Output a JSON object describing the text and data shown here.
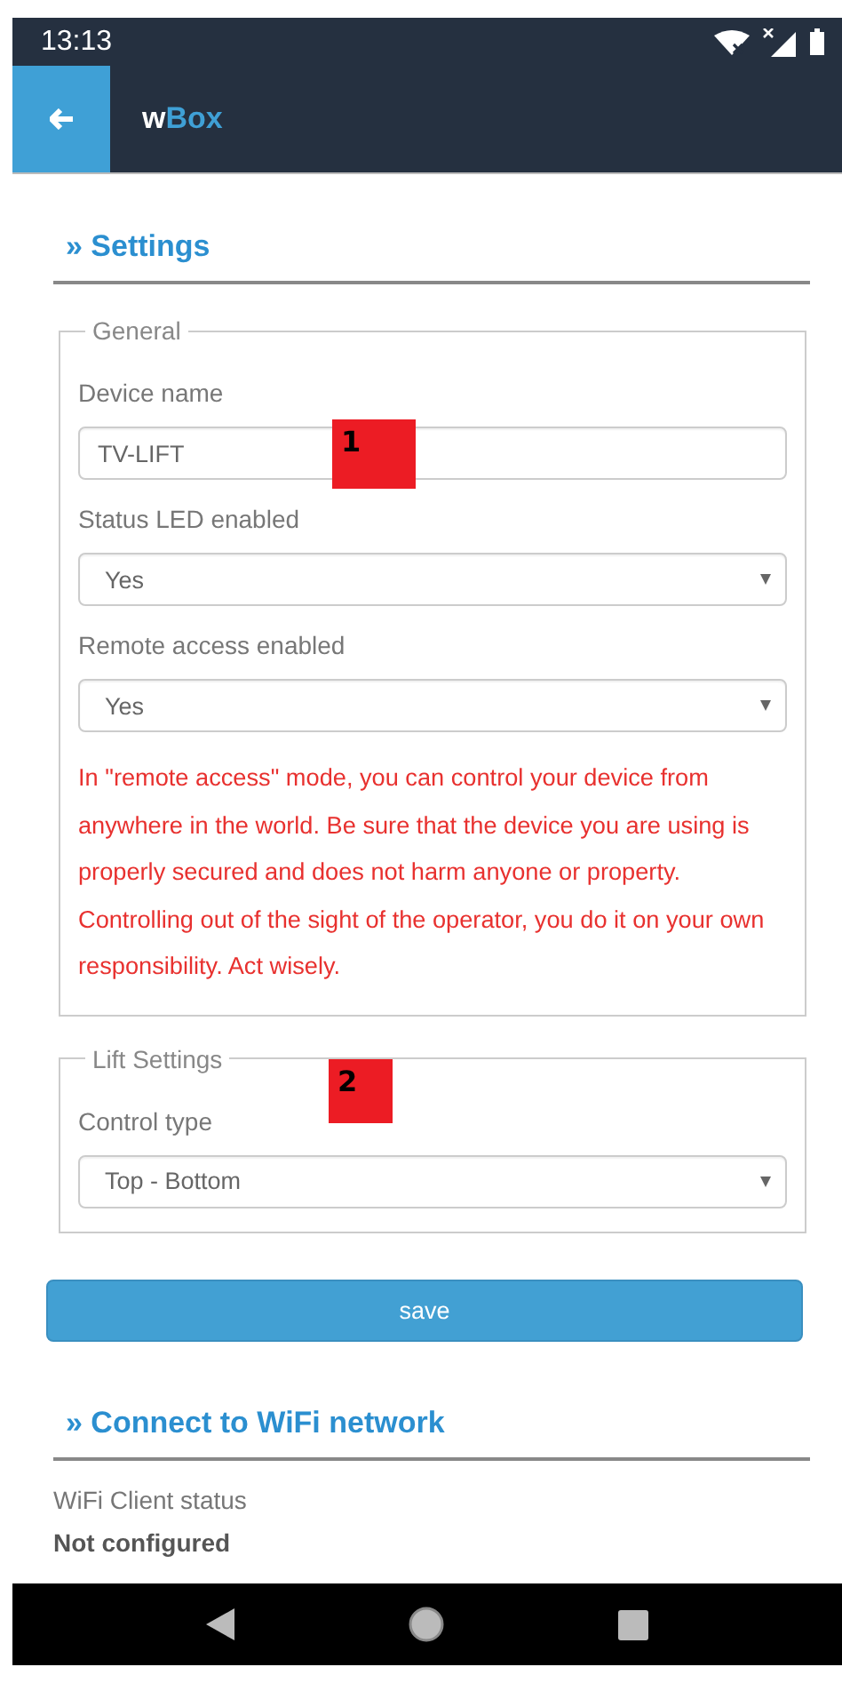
{
  "status_bar": {
    "time": "13:13"
  },
  "app_bar": {
    "title": {
      "plain": "w",
      "accent": "Box"
    }
  },
  "sections": [
    {
      "heading": "» Settings",
      "fieldsets": [
        {
          "legend": "General",
          "marker": "1",
          "fields": [
            {
              "kind": "text",
              "label": "Device name",
              "value": "TV-LIFT"
            },
            {
              "kind": "select",
              "label": "Status LED enabled",
              "value": "Yes"
            },
            {
              "kind": "select",
              "label": "Remote access enabled",
              "value": "Yes"
            }
          ],
          "notice": "In \"remote access\" mode, you can control your device from anywhere in the world. Be sure that the device you are using is properly secured and does not harm anyone or property. Controlling out of the sight of the operator, you do it on your own responsibility. Act wisely."
        },
        {
          "legend": "Lift Settings",
          "marker": "2",
          "fields": [
            {
              "kind": "select",
              "label": "Control type",
              "value": "Top - Bottom"
            }
          ]
        }
      ],
      "button": "save"
    },
    {
      "heading": "» Connect to WiFi network",
      "status_label": "WiFi Client status",
      "status_value": "Not configured"
    }
  ]
}
